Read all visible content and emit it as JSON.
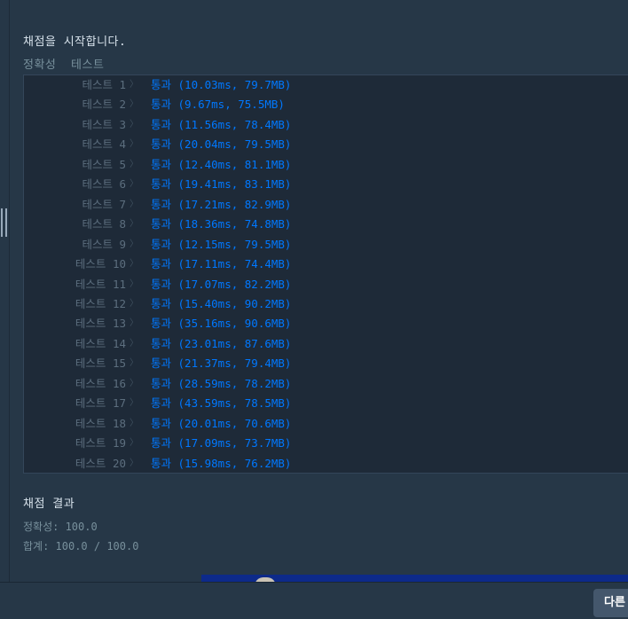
{
  "header": {
    "grading_start": "채점을 시작합니다.",
    "section_accuracy": "정확성",
    "section_test": "테스트"
  },
  "tests": [
    {
      "label": "테스트 1",
      "result": "통과 (10.03ms, 79.7MB)"
    },
    {
      "label": "테스트 2",
      "result": "통과 (9.67ms, 75.5MB)"
    },
    {
      "label": "테스트 3",
      "result": "통과 (11.56ms, 78.4MB)"
    },
    {
      "label": "테스트 4",
      "result": "통과 (20.04ms, 79.5MB)"
    },
    {
      "label": "테스트 5",
      "result": "통과 (12.40ms, 81.1MB)"
    },
    {
      "label": "테스트 6",
      "result": "통과 (19.41ms, 83.1MB)"
    },
    {
      "label": "테스트 7",
      "result": "통과 (17.21ms, 82.9MB)"
    },
    {
      "label": "테스트 8",
      "result": "통과 (18.36ms, 74.8MB)"
    },
    {
      "label": "테스트 9",
      "result": "통과 (12.15ms, 79.5MB)"
    },
    {
      "label": "테스트 10",
      "result": "통과 (17.11ms, 74.4MB)"
    },
    {
      "label": "테스트 11",
      "result": "통과 (17.07ms, 82.2MB)"
    },
    {
      "label": "테스트 12",
      "result": "통과 (15.40ms, 90.2MB)"
    },
    {
      "label": "테스트 13",
      "result": "통과 (35.16ms, 90.6MB)"
    },
    {
      "label": "테스트 14",
      "result": "통과 (23.01ms, 87.6MB)"
    },
    {
      "label": "테스트 15",
      "result": "통과 (21.37ms, 79.4MB)"
    },
    {
      "label": "테스트 16",
      "result": "통과 (28.59ms, 78.2MB)"
    },
    {
      "label": "테스트 17",
      "result": "통과 (43.59ms, 78.5MB)"
    },
    {
      "label": "테스트 18",
      "result": "통과 (20.01ms, 70.6MB)"
    },
    {
      "label": "테스트 19",
      "result": "통과 (17.09ms, 73.7MB)"
    },
    {
      "label": "테스트 20",
      "result": "통과 (15.98ms, 76.2MB)"
    }
  ],
  "summary": {
    "title": "채점 결과",
    "accuracy": "정확성: 100.0",
    "total": "합계: 100.0 / 100.0"
  },
  "footer": {
    "next_button_label": "다른"
  },
  "colors": {
    "background": "#263747",
    "results_background": "#1e2a38",
    "pass_text": "#0078ff",
    "muted_text": "#78909c",
    "button": "#44576c"
  }
}
